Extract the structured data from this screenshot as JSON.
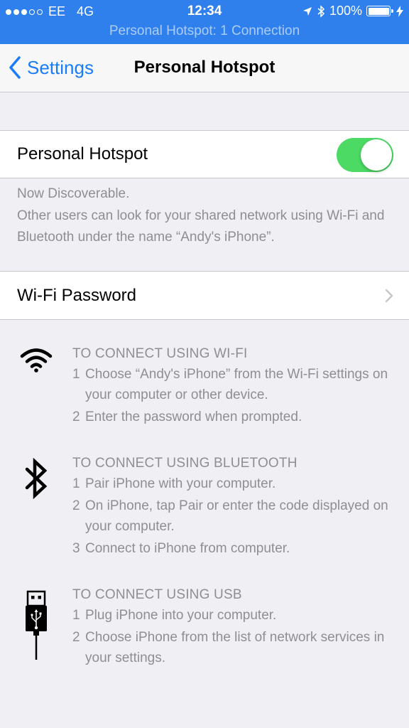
{
  "status_bar": {
    "carrier": "EE",
    "network": "4G",
    "time": "12:34",
    "battery": "100%",
    "signal_bars_filled": 3,
    "signal_bars_total": 5
  },
  "banner": "Personal Hotspot: 1 Connection",
  "nav": {
    "back_label": "Settings",
    "title": "Personal Hotspot"
  },
  "hotspot": {
    "label": "Personal Hotspot",
    "enabled": true,
    "footer_line1": "Now Discoverable.",
    "footer_line2": "Other users can look for your shared network using Wi-Fi and Bluetooth under the name “Andy's iPhone”."
  },
  "wifi_password": {
    "label": "Wi-Fi Password",
    "value": ""
  },
  "instructions": {
    "wifi": {
      "heading": "TO CONNECT USING WI-FI",
      "steps": [
        {
          "num": "1",
          "text": "Choose “Andy's iPhone” from the Wi-Fi settings on your computer or other device."
        },
        {
          "num": "2",
          "text": "Enter the password when prompted."
        }
      ]
    },
    "bluetooth": {
      "heading": "TO CONNECT USING BLUETOOTH",
      "steps": [
        {
          "num": "1",
          "text": "Pair iPhone with your computer."
        },
        {
          "num": "2",
          "text": "On iPhone, tap Pair or enter the code displayed on your computer."
        },
        {
          "num": "3",
          "text": "Connect to iPhone from computer."
        }
      ]
    },
    "usb": {
      "heading": "TO CONNECT USING USB",
      "steps": [
        {
          "num": "1",
          "text": "Plug iPhone into your computer."
        },
        {
          "num": "2",
          "text": "Choose iPhone from the list of network services in your settings."
        }
      ]
    }
  },
  "colors": {
    "status_bar": "#2f80ed",
    "tint": "#1a7cfa",
    "toggle_on": "#4cd964",
    "background": "#efeff4",
    "secondary_text": "#8e8e93"
  },
  "icons": [
    "location-arrow-icon",
    "bluetooth-icon",
    "battery-icon",
    "charging-bolt-icon",
    "back-chevron-icon",
    "disclosure-chevron-icon",
    "wifi-icon",
    "bluetooth-large-icon",
    "usb-cable-icon"
  ]
}
